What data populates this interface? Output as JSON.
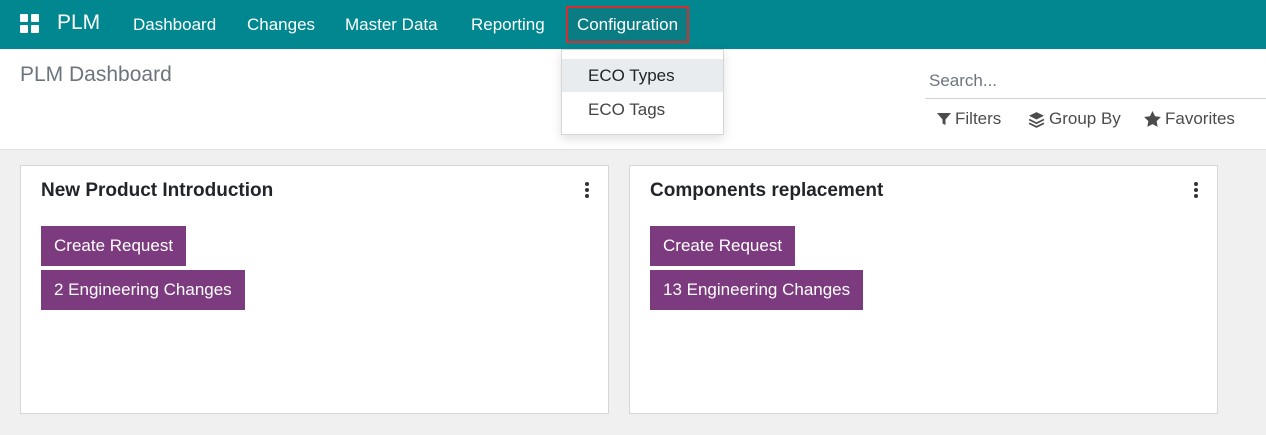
{
  "navbar": {
    "brand": "PLM",
    "menu": {
      "dashboard": "Dashboard",
      "changes": "Changes",
      "master_data": "Master Data",
      "reporting": "Reporting",
      "configuration": "Configuration"
    },
    "color": "#00878f"
  },
  "page": {
    "title": "PLM Dashboard"
  },
  "config_dropdown": {
    "items": [
      "ECO Types",
      "ECO Tags"
    ]
  },
  "search": {
    "placeholder": "Search...",
    "value": ""
  },
  "filters": {
    "filters_label": "Filters",
    "group_by_label": "Group By",
    "favorites_label": "Favorites"
  },
  "cards": [
    {
      "title": "New Product Introduction",
      "create_label": "Create Request",
      "changes_label": "2 Engineering Changes"
    },
    {
      "title": "Components replacement",
      "create_label": "Create Request",
      "changes_label": "13 Engineering Changes"
    }
  ],
  "colors": {
    "accent": "#00878f",
    "button": "#7c3b7e",
    "highlight": "#d32f2f"
  },
  "icons": [
    "apps-grid-icon",
    "filter-icon",
    "layers-icon",
    "star-icon",
    "kebab-menu-icon"
  ]
}
